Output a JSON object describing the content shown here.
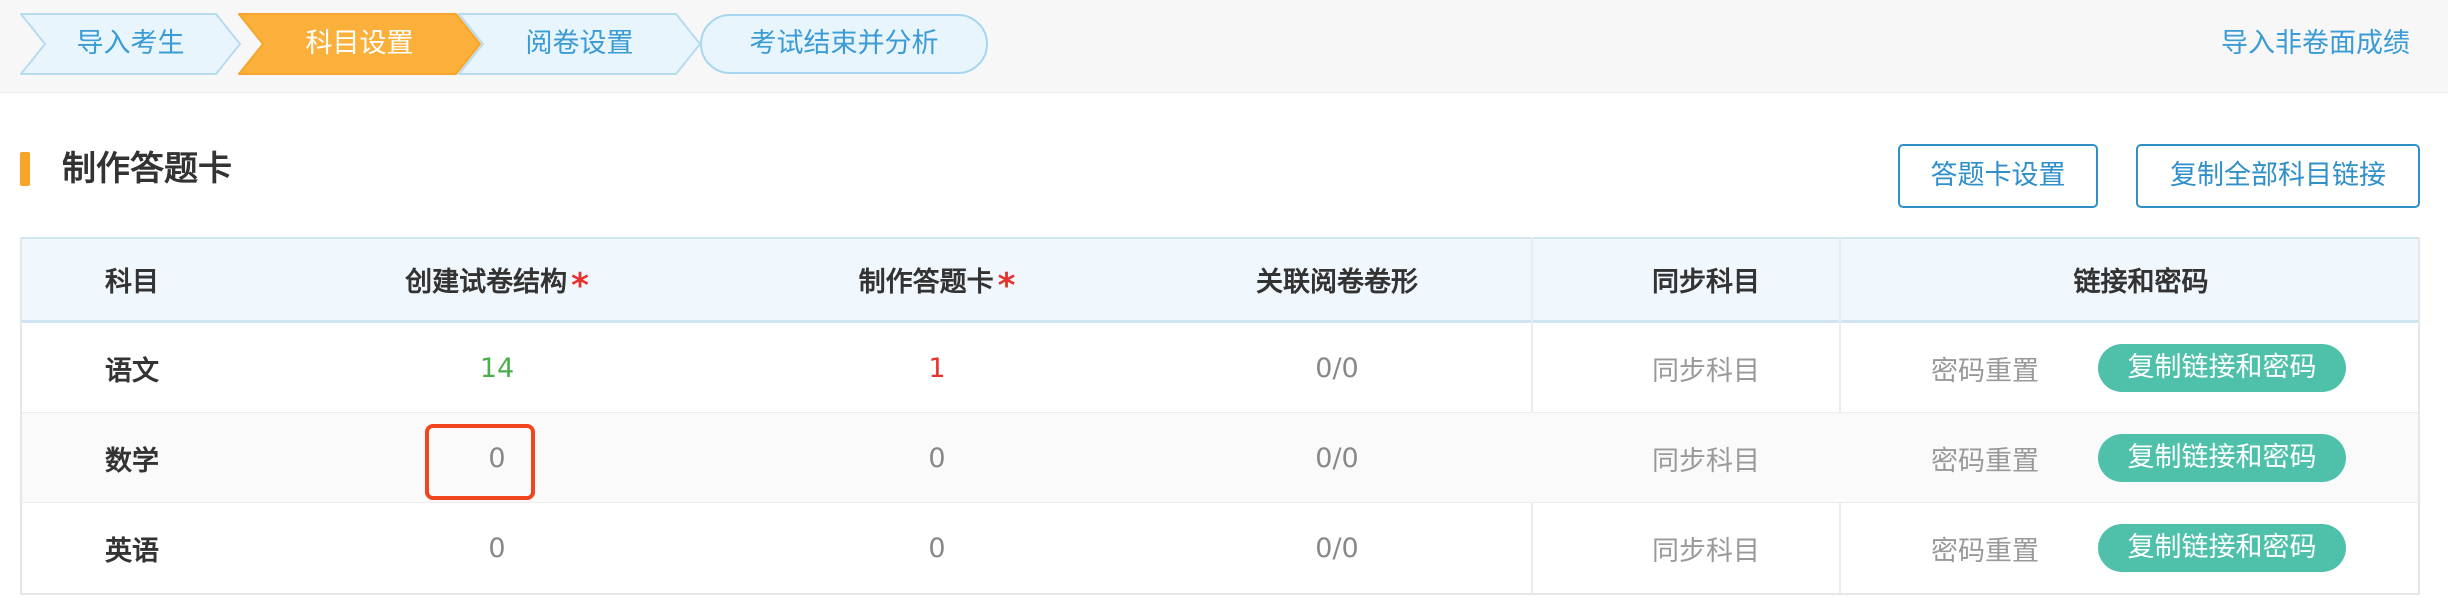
{
  "steps": [
    {
      "label": "导入考生",
      "active": false
    },
    {
      "label": "科目设置",
      "active": true
    },
    {
      "label": "阅卷设置",
      "active": false
    }
  ],
  "final_step": "考试结束并分析",
  "import_link": "导入非卷面成绩",
  "section_title": "制作答题卡",
  "actions": {
    "card_settings": "答题卡设置",
    "copy_all_links": "复制全部科目链接"
  },
  "table": {
    "headers": [
      "科目",
      "创建试卷结构",
      "制作答题卡",
      "关联阅卷卷形",
      "同步科目",
      "链接和密码"
    ],
    "required_star": "*",
    "rows": [
      {
        "subject": "语文",
        "structure": "14",
        "card": "1",
        "shape": "0/0",
        "sync": "同步科目",
        "reset": "密码重置",
        "copy": "复制链接和密码"
      },
      {
        "subject": "数学",
        "structure": "0",
        "card": "0",
        "shape": "0/0",
        "sync": "同步科目",
        "reset": "密码重置",
        "copy": "复制链接和密码"
      },
      {
        "subject": "英语",
        "structure": "0",
        "card": "0",
        "shape": "0/0",
        "sync": "同步科目",
        "reset": "密码重置",
        "copy": "复制链接和密码"
      }
    ]
  },
  "colors": {
    "accent_blue": "#3a9bd5",
    "active_step": "#fbb03b",
    "copy_button": "#4fc1ab",
    "required": "#e8322e",
    "highlight": "#f0451e"
  }
}
